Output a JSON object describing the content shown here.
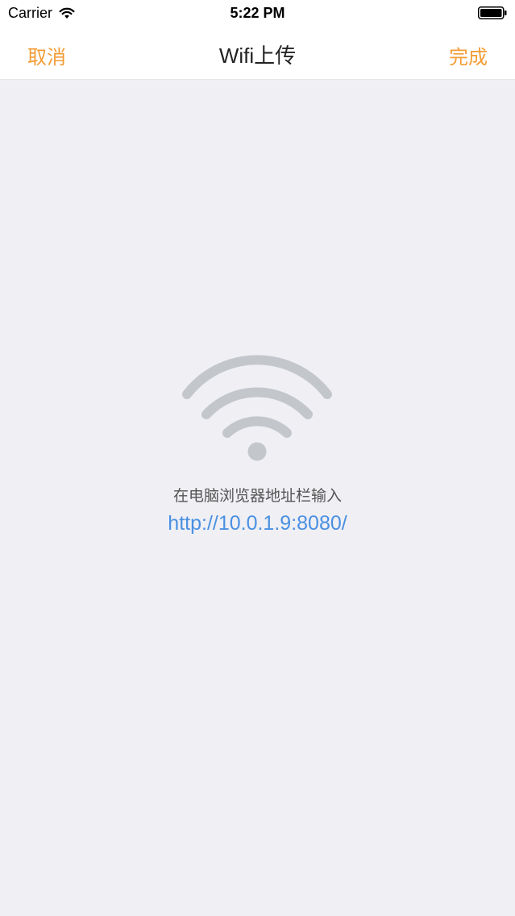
{
  "status_bar": {
    "carrier": "Carrier",
    "time": "5:22 PM"
  },
  "nav": {
    "cancel_label": "取消",
    "title": "Wifi上传",
    "done_label": "完成",
    "accent_color": "#f39c35"
  },
  "content": {
    "icon": "wifi-icon",
    "instruction": "在电脑浏览器地址栏输入",
    "url": "http://10.0.1.9:8080/",
    "url_color": "#4a90e2"
  }
}
